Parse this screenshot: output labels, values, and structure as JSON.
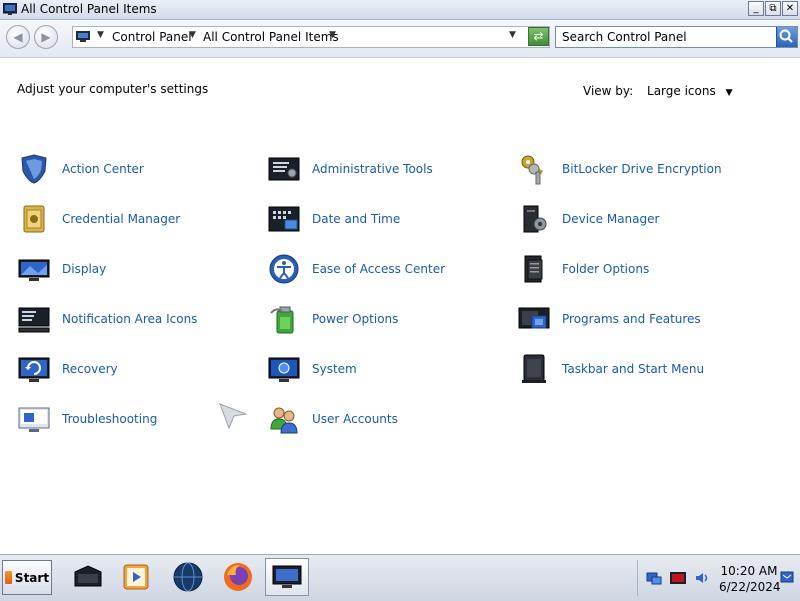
{
  "window": {
    "title": "All Control Panel Items",
    "controls": [
      "_",
      "⧉",
      "✕"
    ]
  },
  "address": {
    "segments": [
      "Control Panel",
      "All Control Panel Items"
    ]
  },
  "search": {
    "placeholder": "Search Control Panel"
  },
  "content": {
    "heading": "Adjust your computer's settings",
    "view_by_label": "View by:",
    "view_by_value": "Large icons"
  },
  "items": [
    {
      "label": "Action Center",
      "icon": "shield-icon"
    },
    {
      "label": "Administrative Tools",
      "icon": "admin-tools-icon"
    },
    {
      "label": "BitLocker Drive Encryption",
      "icon": "keys-icon"
    },
    {
      "label": "Credential Manager",
      "icon": "vault-icon"
    },
    {
      "label": "Date and Time",
      "icon": "clock-icon"
    },
    {
      "label": "Device Manager",
      "icon": "device-manager-icon"
    },
    {
      "label": "Display",
      "icon": "monitor-icon"
    },
    {
      "label": "Ease of Access Center",
      "icon": "ease-of-access-icon"
    },
    {
      "label": "Folder Options",
      "icon": "folder-options-icon"
    },
    {
      "label": "Notification Area Icons",
      "icon": "notification-icon"
    },
    {
      "label": "Power Options",
      "icon": "power-icon"
    },
    {
      "label": "Programs and Features",
      "icon": "programs-icon"
    },
    {
      "label": "Recovery",
      "icon": "recovery-icon"
    },
    {
      "label": "System",
      "icon": "system-icon"
    },
    {
      "label": "Taskbar and Start Menu",
      "icon": "taskbar-icon"
    },
    {
      "label": "Troubleshooting",
      "icon": "troubleshooting-icon"
    },
    {
      "label": "User Accounts",
      "icon": "users-icon"
    }
  ],
  "taskbar": {
    "start_label": "Start",
    "apps": [
      "file-manager-icon",
      "media-player-icon",
      "globe-icon",
      "firefox-icon",
      "control-panel-icon"
    ],
    "tray_icons": [
      "network-icon",
      "security-icon",
      "volume-icon",
      "notification-flag-icon"
    ],
    "time": "10:20 AM",
    "date": "6/22/2024"
  },
  "colors": {
    "link": "#1a5ba6"
  }
}
